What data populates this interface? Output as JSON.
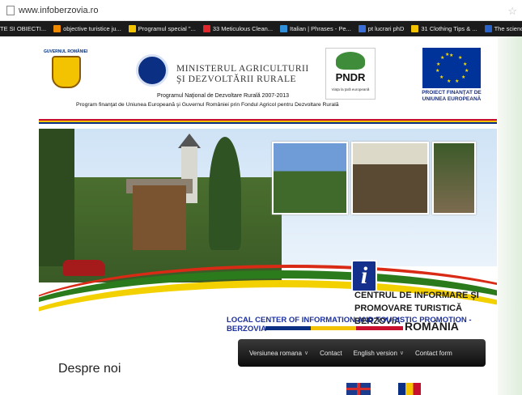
{
  "browser": {
    "url": "www.infoberzovia.ro"
  },
  "bookmarks": [
    {
      "label": "TE SI OBIECTI...",
      "color": "#1b1b1b"
    },
    {
      "label": "objective turistice ju...",
      "color": "#f08a00"
    },
    {
      "label": "Programul special \"...",
      "color": "#f3c200"
    },
    {
      "label": "33 Meticulous Clean...",
      "color": "#e0272b"
    },
    {
      "label": "Italian | Phrases - Pe...",
      "color": "#2f8fd8"
    },
    {
      "label": "pt lucrari phD",
      "color": "#3b6fd6"
    },
    {
      "label": "31 Clothing Tips & ...",
      "color": "#f3c200"
    },
    {
      "label": "The sciences of scie...",
      "color": "#2a62c8"
    }
  ],
  "header": {
    "gov_label": "GUVERNUL ROMÂNIEI",
    "ministry": [
      "MINISTERUL AGRICULTURII",
      "ŞI DEZVOLTĂRII RURALE"
    ],
    "pndr_logo": "PNDR",
    "pndr_sub": "Viaţa la ţară europeană",
    "eu_label": [
      "PROIECT FINANŢAT DE",
      "UNIUNEA EUROPEANĂ"
    ],
    "program_line1": "Programul Naţional de Dezvoltare Rurală 2007-2013",
    "program_line2": "Program finanţat de Uniunea Europeană şi Guvernul României prin Fondul Agricol pentru Dezvoltare Rurală"
  },
  "banner": {
    "info_icon": "i",
    "centre_title": [
      "CENTRUL DE INFORMARE ŞI",
      "PROMOVARE TURISTICĂ BERZOVIA"
    ],
    "country": "ROMÂNIA",
    "local_title": "LOCAL CENTER OF INFORMATION AND TOURISTIC PROMOTION - BERZOVIA"
  },
  "nav": [
    {
      "label": "Versiunea romana",
      "dropdown": true
    },
    {
      "label": "Contact",
      "dropdown": false
    },
    {
      "label": "English version",
      "dropdown": true
    },
    {
      "label": "Contact form",
      "dropdown": false
    }
  ],
  "main": {
    "heading": "Despre noi"
  }
}
